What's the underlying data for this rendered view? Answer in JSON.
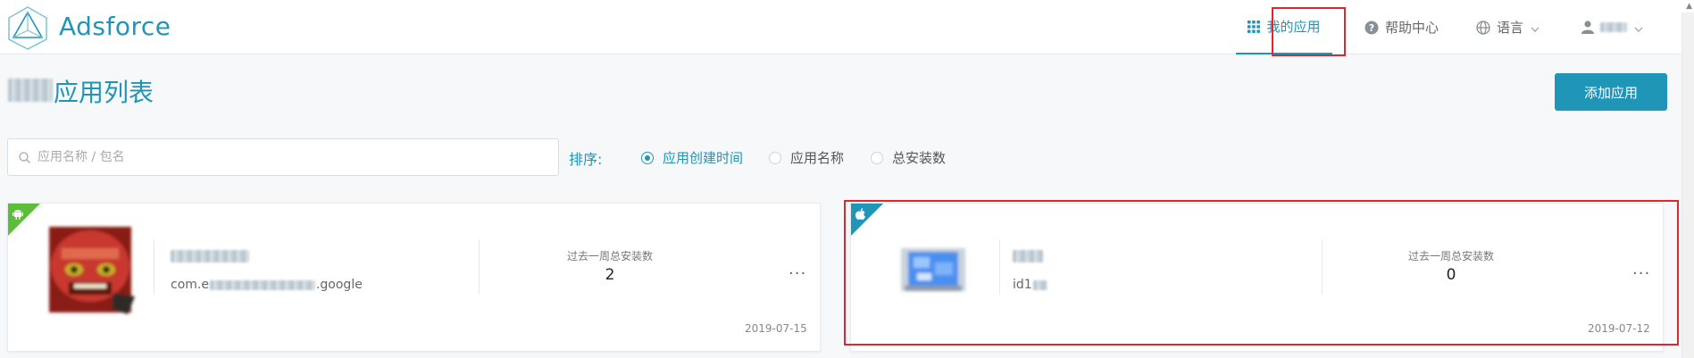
{
  "header": {
    "brand": "Adsforce",
    "nav": {
      "my_apps": "我的应用",
      "help": "帮助中心",
      "language": "语言"
    },
    "user_name": "user"
  },
  "page": {
    "title": "应用列表",
    "add_button": "添加应用"
  },
  "search": {
    "placeholder": "应用名称 / 包名",
    "value": ""
  },
  "sort": {
    "label": "排序:",
    "options": [
      "应用创建时间",
      "应用名称",
      "总安装数"
    ],
    "selected": "应用创建时间"
  },
  "apps": [
    {
      "platform": "android",
      "platform_color": "#5bbd3a",
      "package_prefix": "com.e",
      "package_suffix": ".google",
      "stat_label": "过去一周总安装数",
      "installs": "2",
      "date": "2019-07-15"
    },
    {
      "platform": "ios",
      "platform_color": "#1f95b8",
      "package_prefix": "id1",
      "package_suffix": "",
      "stat_label": "过去一周总安装数",
      "installs": "0",
      "date": "2019-07-12"
    }
  ],
  "colors": {
    "accent": "#1f95b8",
    "highlight": "#e3262e"
  },
  "icons": {
    "logo": "triangle-logo-icon",
    "my_apps": "grid-icon",
    "help": "question-circle-icon",
    "language": "globe-icon",
    "user": "user-icon",
    "search": "search-icon",
    "android": "android-icon",
    "ios": "apple-icon",
    "more": "ellipsis-icon"
  }
}
